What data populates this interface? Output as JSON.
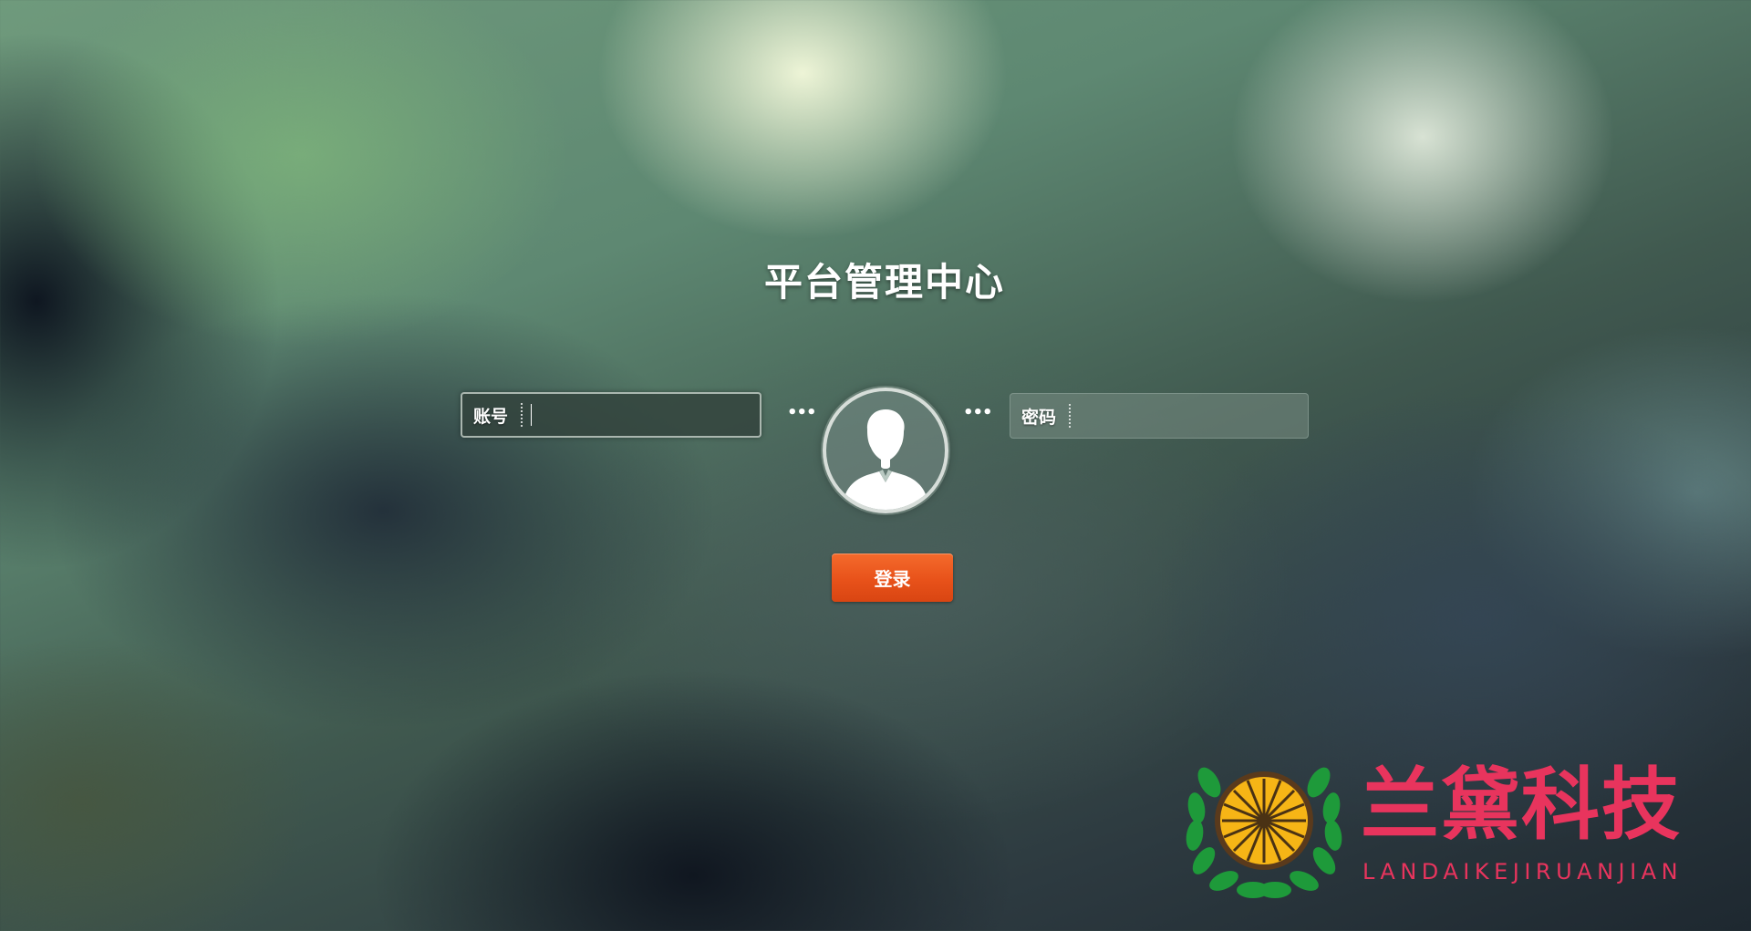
{
  "page": {
    "title": "平台管理中心"
  },
  "login_form": {
    "account_label": "账号",
    "account_value": "",
    "password_label": "密码",
    "password_value": "",
    "separator_left": "•••",
    "separator_right": "•••",
    "login_label": "登录"
  },
  "brand": {
    "name": "兰黛科技",
    "subtitle": "LANDAIKEJIRUANJIAN",
    "color": "#e8345d"
  },
  "icons": {
    "avatar": "user-avatar-icon",
    "logo": "laurel-wheel-logo-icon"
  },
  "colors": {
    "button": "#e8521a",
    "text": "#ffffff"
  }
}
